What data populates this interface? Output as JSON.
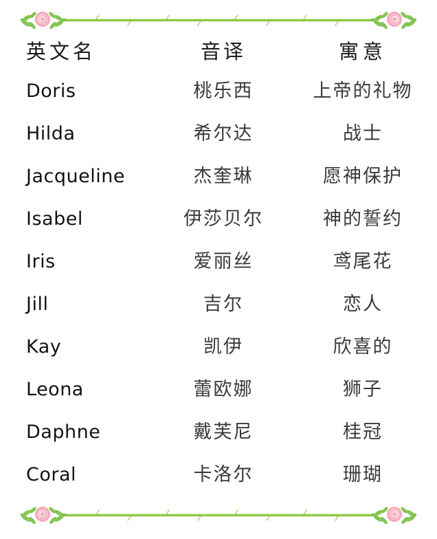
{
  "decoration": {
    "top_divider": "rose-vine-divider",
    "bottom_divider": "rose-vine-divider",
    "vine_color": "#8cc63f",
    "leaf_color": "#7ec24a",
    "rose_color": "#f6a8bb",
    "rose_center_color": "#fbd4dd"
  },
  "table": {
    "headers": {
      "english": "英文名",
      "transliteration": "音译",
      "meaning": "寓意"
    },
    "rows": [
      {
        "english": "Doris",
        "transliteration": "桃乐西",
        "meaning": "上帝的礼物"
      },
      {
        "english": "Hilda",
        "transliteration": "希尔达",
        "meaning": "战士"
      },
      {
        "english": "Jacqueline",
        "transliteration": "杰奎琳",
        "meaning": "愿神保护"
      },
      {
        "english": "Isabel",
        "transliteration": "伊莎贝尔",
        "meaning": "神的誓约"
      },
      {
        "english": "Iris",
        "transliteration": "爱丽丝",
        "meaning": "鸢尾花"
      },
      {
        "english": "Jill",
        "transliteration": "吉尔",
        "meaning": "恋人"
      },
      {
        "english": "Kay",
        "transliteration": "凯伊",
        "meaning": "欣喜的"
      },
      {
        "english": "Leona",
        "transliteration": "蕾欧娜",
        "meaning": "狮子"
      },
      {
        "english": "Daphne",
        "transliteration": "戴芙尼",
        "meaning": "桂冠"
      },
      {
        "english": "Coral",
        "transliteration": "卡洛尔",
        "meaning": "珊瑚"
      }
    ]
  }
}
